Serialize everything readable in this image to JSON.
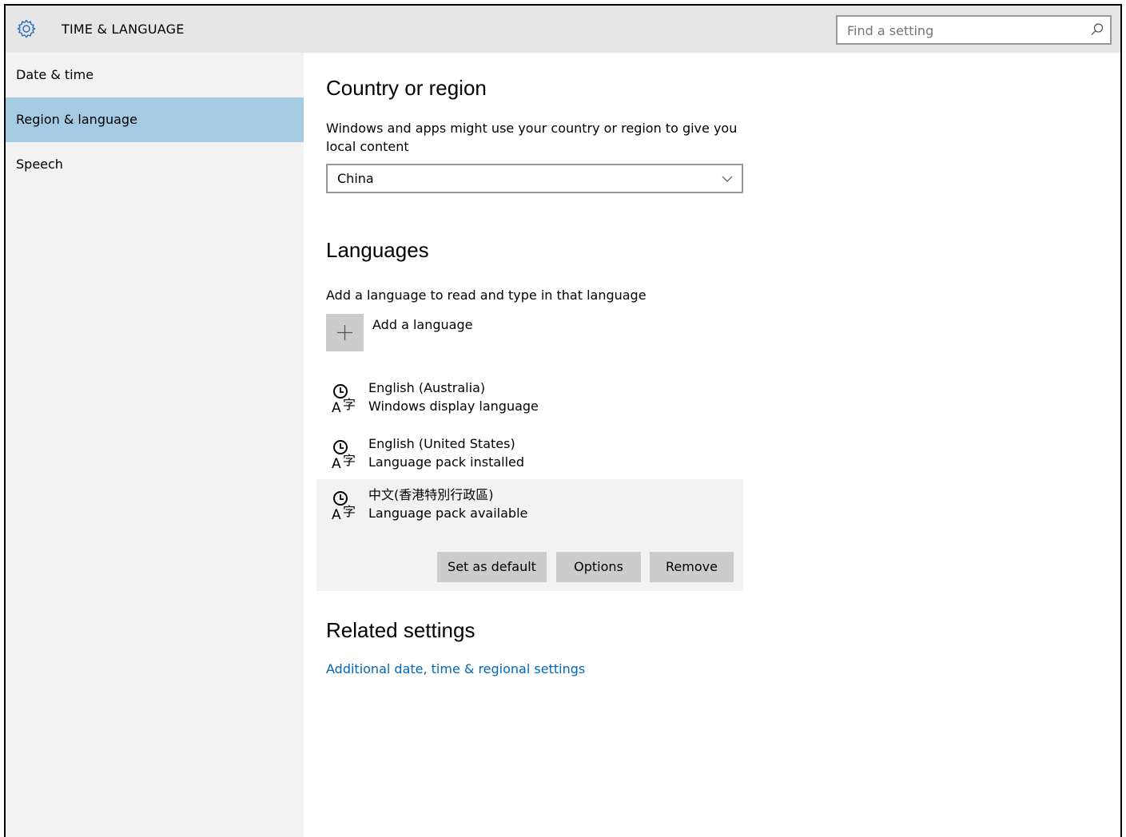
{
  "header": {
    "title": "TIME & LANGUAGE",
    "icon": "gear-icon",
    "search": {
      "placeholder": "Find a setting",
      "icon": "search-icon"
    }
  },
  "sidebar": {
    "items": [
      {
        "label": "Date & time",
        "selected": false
      },
      {
        "label": "Region & language",
        "selected": true
      },
      {
        "label": "Speech",
        "selected": false
      }
    ]
  },
  "main": {
    "country": {
      "heading": "Country or region",
      "description": "Windows and apps might use your country or region to give you local content",
      "selected_value": "China"
    },
    "languages": {
      "heading": "Languages",
      "description": "Add a language to read and type in that language",
      "add_label": "Add a language",
      "items": [
        {
          "name": "English (Australia)",
          "status": "Windows display language"
        },
        {
          "name": "English (United States)",
          "status": "Language pack installed"
        },
        {
          "name": "中文(香港特別行政區)",
          "status": "Language pack available",
          "selected": true
        }
      ],
      "actions": {
        "set_default": "Set as default",
        "options": "Options",
        "remove": "Remove"
      }
    },
    "related": {
      "heading": "Related settings",
      "link": "Additional date, time & regional settings"
    }
  },
  "colors": {
    "accent": "#0067b8",
    "selected_nav": "#a5cbe3",
    "titlebar": "#e6e6e6",
    "sidebar": "#f2f2f2"
  }
}
